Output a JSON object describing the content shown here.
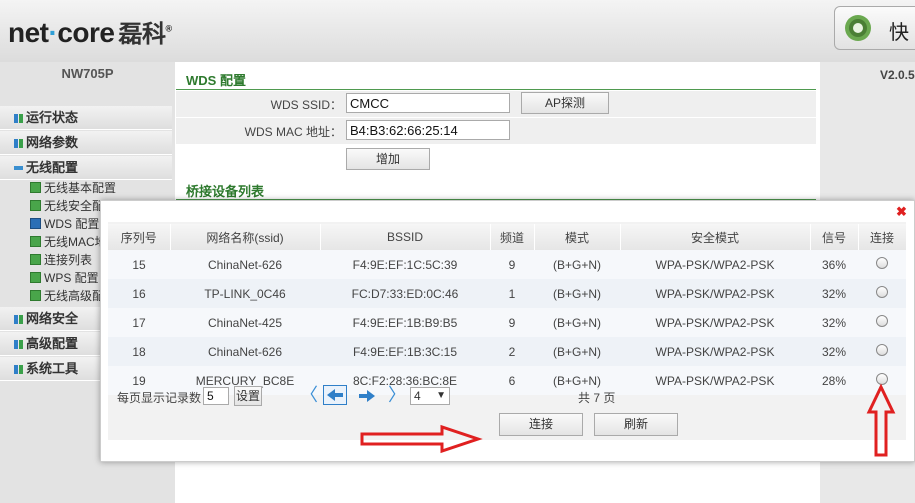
{
  "header": {
    "brand_a": "net",
    "brand_b": "core",
    "brand_cn": "磊科",
    "quick_label": "快"
  },
  "sidebar": {
    "model": "NW705P",
    "menu": [
      {
        "label": "运行状态"
      },
      {
        "label": "网络参数"
      },
      {
        "label": "无线配置"
      }
    ],
    "submenu": [
      {
        "label": "无线基本配置"
      },
      {
        "label": "无线安全配"
      },
      {
        "label": "WDS 配置"
      },
      {
        "label": "无线MAC地"
      },
      {
        "label": "连接列表"
      },
      {
        "label": "WPS 配置"
      },
      {
        "label": "无线高级配"
      }
    ],
    "menu2": [
      {
        "label": "网络安全"
      },
      {
        "label": "高级配置"
      },
      {
        "label": "系统工具"
      }
    ]
  },
  "version": "V2.0.5",
  "wds": {
    "title": "WDS 配置",
    "ssid_label": "WDS SSID：",
    "ssid_value": "CMCC",
    "ap_scan_button": "AP探测",
    "mac_label": "WDS MAC 地址：",
    "mac_value": "B4:B3:62:66:25:14",
    "add_button": "增加",
    "bridge_title": "桥接设备列表"
  },
  "dialog": {
    "close": "✖",
    "columns": [
      "序列号",
      "网络名称(ssid)",
      "BSSID",
      "频道",
      "模式",
      "安全模式",
      "信号",
      "连接"
    ],
    "rows": [
      {
        "no": "15",
        "ssid": "ChinaNet-626",
        "bssid": "F4:9E:EF:1C:5C:39",
        "channel": "9",
        "mode": "(B+G+N)",
        "security": "WPA-PSK/WPA2-PSK",
        "signal": "36%"
      },
      {
        "no": "16",
        "ssid": "TP-LINK_0C46",
        "bssid": "FC:D7:33:ED:0C:46",
        "channel": "1",
        "mode": "(B+G+N)",
        "security": "WPA-PSK/WPA2-PSK",
        "signal": "32%"
      },
      {
        "no": "17",
        "ssid": "ChinaNet-425",
        "bssid": "F4:9E:EF:1B:B9:B5",
        "channel": "9",
        "mode": "(B+G+N)",
        "security": "WPA-PSK/WPA2-PSK",
        "signal": "32%"
      },
      {
        "no": "18",
        "ssid": "ChinaNet-626",
        "bssid": "F4:9E:EF:1B:3C:15",
        "channel": "2",
        "mode": "(B+G+N)",
        "security": "WPA-PSK/WPA2-PSK",
        "signal": "32%"
      },
      {
        "no": "19",
        "ssid": "MERCURY_BC8E",
        "bssid": "8C:F2:28:36:BC:8E",
        "channel": "6",
        "mode": "(B+G+N)",
        "security": "WPA-PSK/WPA2-PSK",
        "signal": "28%"
      }
    ],
    "per_page_label": "每页显示记录数",
    "per_page_value": "5",
    "set_button": "设置",
    "page_select": "4",
    "total_pages": "共 7 页",
    "connect_button": "连接",
    "refresh_button": "刷新"
  },
  "colors": {
    "section_green": "#2e7a2e",
    "annotation_red": "#e02020",
    "arrow_blue": "#3b8fd6"
  }
}
